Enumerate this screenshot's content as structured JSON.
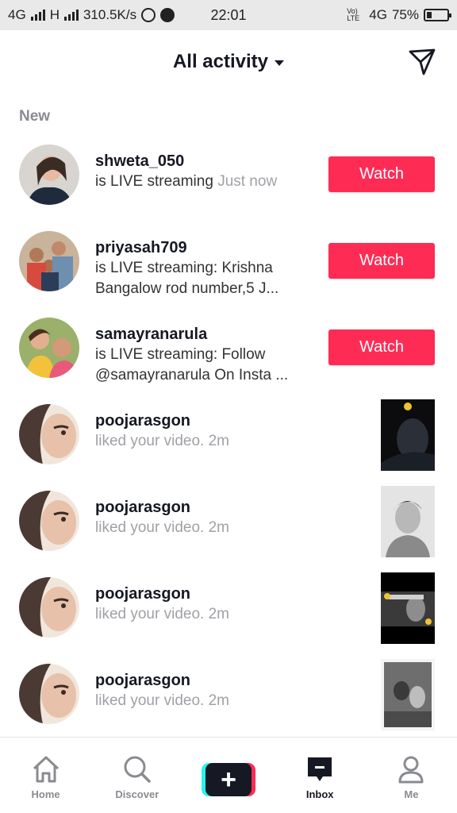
{
  "status_bar": {
    "network1": "4G",
    "network2": "H",
    "speed": "310.5K/s",
    "time": "22:01",
    "volte": "Vo) LTE",
    "network3": "4G",
    "battery": "75%",
    "battery_level_percent": 75
  },
  "header": {
    "title": "All activity",
    "send_icon": "send-paper-plane-icon"
  },
  "section_label": "New",
  "live_items": [
    {
      "username": "shweta_050",
      "message": "is LIVE streaming",
      "time": "Just now",
      "button": "Watch"
    },
    {
      "username": "priyasah709",
      "message": "is LIVE streaming: Krishna Bangalow  rod number,5 J...",
      "button": "Watch"
    },
    {
      "username": "samayranarula",
      "message": "is LIVE streaming: Follow @samayranarula On Insta ...",
      "button": "Watch"
    }
  ],
  "like_items": [
    {
      "username": "poojarasgon",
      "message": "liked your video.",
      "time": "2m"
    },
    {
      "username": "poojarasgon",
      "message": "liked your video.",
      "time": "2m"
    },
    {
      "username": "poojarasgon",
      "message": "liked your video.",
      "time": "2m"
    },
    {
      "username": "poojarasgon",
      "message": "liked your video.",
      "time": "2m"
    }
  ],
  "bottom_nav": {
    "home": "Home",
    "discover": "Discover",
    "create": "+",
    "inbox": "Inbox",
    "me": "Me"
  },
  "colors": {
    "accent": "#fe2c55",
    "cyan": "#25f4ee",
    "text": "#161823",
    "muted": "#a0a1a6"
  }
}
